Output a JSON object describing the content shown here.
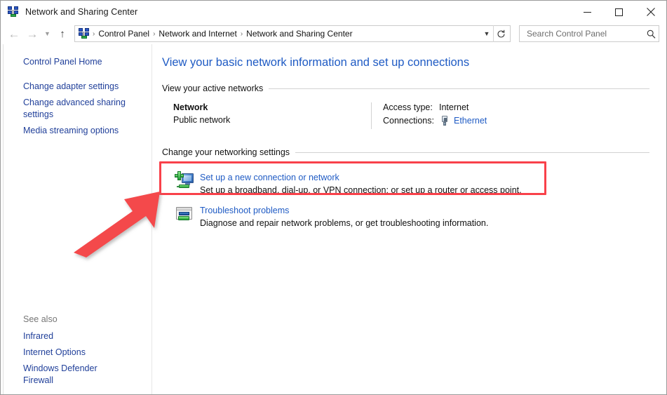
{
  "window": {
    "title": "Network and Sharing Center",
    "icon": "network-icon",
    "controls": {
      "minimize": "minimize-icon",
      "maximize": "maximize-icon",
      "close": "close-icon"
    }
  },
  "addressbar": {
    "back": "back-arrow-icon",
    "forward": "forward-arrow-icon",
    "recent": "chevron-down-icon",
    "up": "up-arrow-icon",
    "path_icon": "network-icon",
    "crumbs": [
      "Control Panel",
      "Network and Internet",
      "Network and Sharing Center"
    ],
    "separator": "›",
    "caret": "chevron-down-icon",
    "refresh": "refresh-icon",
    "search": {
      "placeholder": "Search Control Panel",
      "value": "",
      "icon": "search-icon"
    }
  },
  "sidebar": {
    "items": [
      {
        "label": "Control Panel Home"
      },
      {
        "label": "Change adapter settings"
      },
      {
        "label": "Change advanced sharing settings"
      },
      {
        "label": "Media streaming options"
      }
    ],
    "see_also": {
      "title": "See also",
      "items": [
        {
          "label": "Infrared"
        },
        {
          "label": "Internet Options"
        },
        {
          "label": "Windows Defender Firewall"
        }
      ]
    }
  },
  "main": {
    "page_title": "View your basic network information and set up connections",
    "active_networks": {
      "heading": "View your active networks",
      "network": {
        "name": "Network",
        "type": "Public network",
        "access_type_label": "Access type:",
        "access_type_value": "Internet",
        "connections_label": "Connections:",
        "connections_value": "Ethernet",
        "connections_icon": "ethernet-plug-icon"
      }
    },
    "networking_settings": {
      "heading": "Change your networking settings",
      "tasks": [
        {
          "icon": "monitor-plus-icon",
          "link": "Set up a new connection or network",
          "description": "Set up a broadband, dial-up, or VPN connection; or set up a router or access point."
        },
        {
          "icon": "troubleshoot-window-icon",
          "link": "Troubleshoot problems",
          "description": "Diagnose and repair network problems, or get troubleshooting information."
        }
      ]
    }
  },
  "annotations": {
    "highlight_color": "#f9414a",
    "arrow_color": "#f4484c",
    "highlight_target": "Set up a new connection or network"
  },
  "colors": {
    "link": "#1f5bc4",
    "sidebar_link": "#21409a",
    "title": "#1f5bc4",
    "text": "#111111",
    "muted": "#767676"
  }
}
